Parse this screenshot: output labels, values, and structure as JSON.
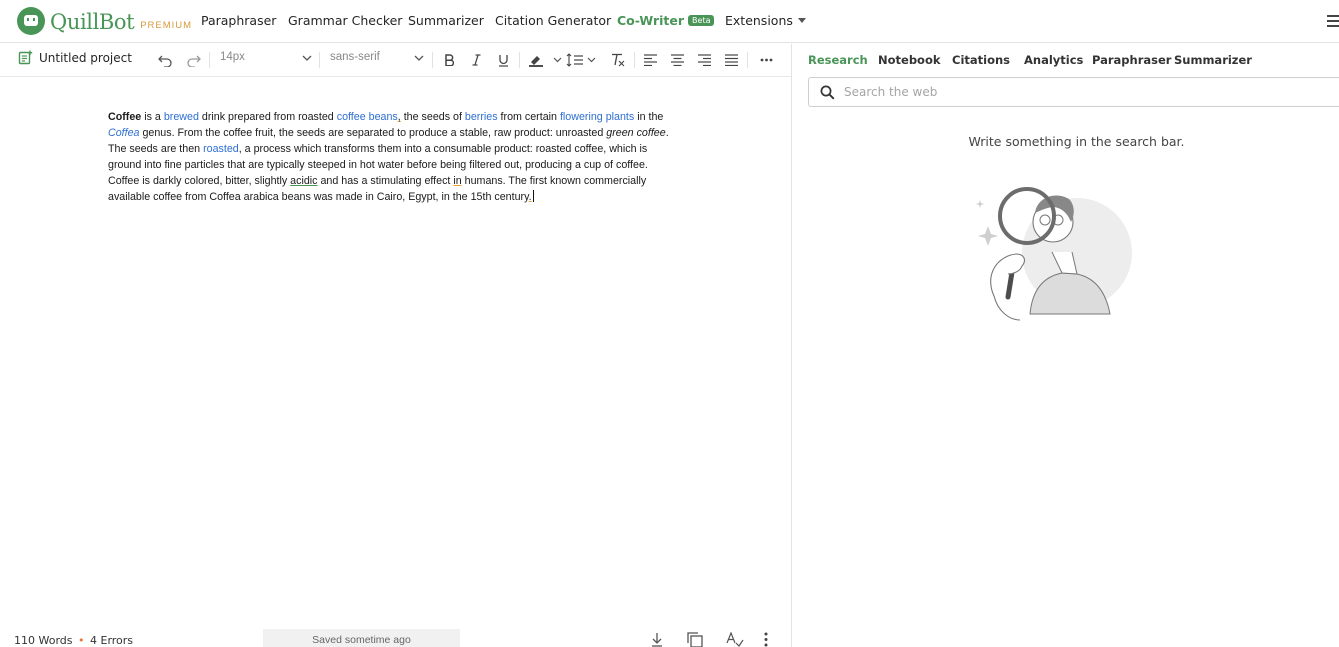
{
  "app": {
    "brand": "QuillBot",
    "tier": "PREMIUM",
    "nav": [
      {
        "label": "Paraphraser"
      },
      {
        "label": "Grammar Checker"
      },
      {
        "label": "Summarizer"
      },
      {
        "label": "Citation Generator"
      },
      {
        "label": "Co-Writer",
        "badge": "Beta"
      },
      {
        "label": "Extensions"
      }
    ]
  },
  "toolbar": {
    "project_name": "Untitled project",
    "font_size": "14px",
    "font_family": "sans-serif"
  },
  "document": {
    "s1": "Coffee",
    "s2": " is a ",
    "s3": "brewed",
    "s4": " drink prepared from roasted ",
    "s5": "coffee beans",
    "s6": ",",
    "s7": " the seeds of ",
    "s8": "berries",
    "s9": " from certain ",
    "s10": "flowering plants",
    "s11": " in the ",
    "s12": "Coffea",
    "s13": " genus. From the coffee fruit, the seeds are separated to produce a stable, raw product: unroasted ",
    "s14": "green coffee",
    "s15": ". The seeds are then ",
    "s16": "roasted",
    "s17": ", a process which transforms them into a consumable product: roasted coffee, which is ground into fine particles that are typically steeped in hot water before being filtered out, producing a cup of coffee. Coffee is darkly colored, bitter, slightly ",
    "s18": "acidic",
    "s19": " and has a stimulating effect ",
    "s20": "in",
    "s21": " humans. The first known commercially available coffee from Coffea arabica beans was made in Cairo, Egypt, in the 15th century",
    "s22": "."
  },
  "footer": {
    "words": "110 Words",
    "separator": "•",
    "errors": "4 Errors",
    "saved": "Saved sometime ago"
  },
  "panel": {
    "tabs": [
      {
        "label": "Research",
        "active": true
      },
      {
        "label": "Notebook"
      },
      {
        "label": "Citations"
      },
      {
        "label": "Analytics"
      },
      {
        "label": "Paraphraser"
      },
      {
        "label": "Summarizer"
      }
    ],
    "search_placeholder": "Search the web",
    "empty_hint": "Write something in the search bar."
  },
  "colors": {
    "brand_green": "#499557",
    "premium_gold": "#d99a3b",
    "link_blue": "#2e6fd1",
    "error_orange": "#e8a23a"
  },
  "icons": [
    "project-icon",
    "undo-icon",
    "redo-icon",
    "bold-icon",
    "italic-icon",
    "underline-icon",
    "highlight-icon",
    "line-spacing-icon",
    "clear-format-icon",
    "align-left-icon",
    "align-center-icon",
    "align-right-icon",
    "align-justify-icon",
    "more-icon",
    "download-icon",
    "copy-icon",
    "spellcheck-icon",
    "kebab-icon",
    "search-icon",
    "hamburger-icon"
  ]
}
